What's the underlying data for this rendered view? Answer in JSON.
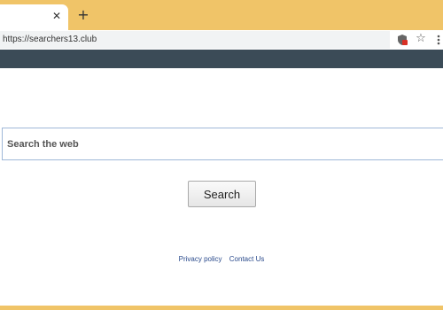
{
  "browser": {
    "tab_close_glyph": "✕",
    "new_tab_glyph": "+",
    "url": "https://searchers13.club",
    "bookmark_glyph": "☆"
  },
  "colors": {
    "frame": "#f0c468",
    "header_bar": "#3b4b57",
    "link": "#2a4a8c"
  },
  "search": {
    "placeholder": "Search the web",
    "button_label": "Search"
  },
  "footer": {
    "privacy_label": "Privacy policy",
    "contact_label": "Contact Us"
  }
}
